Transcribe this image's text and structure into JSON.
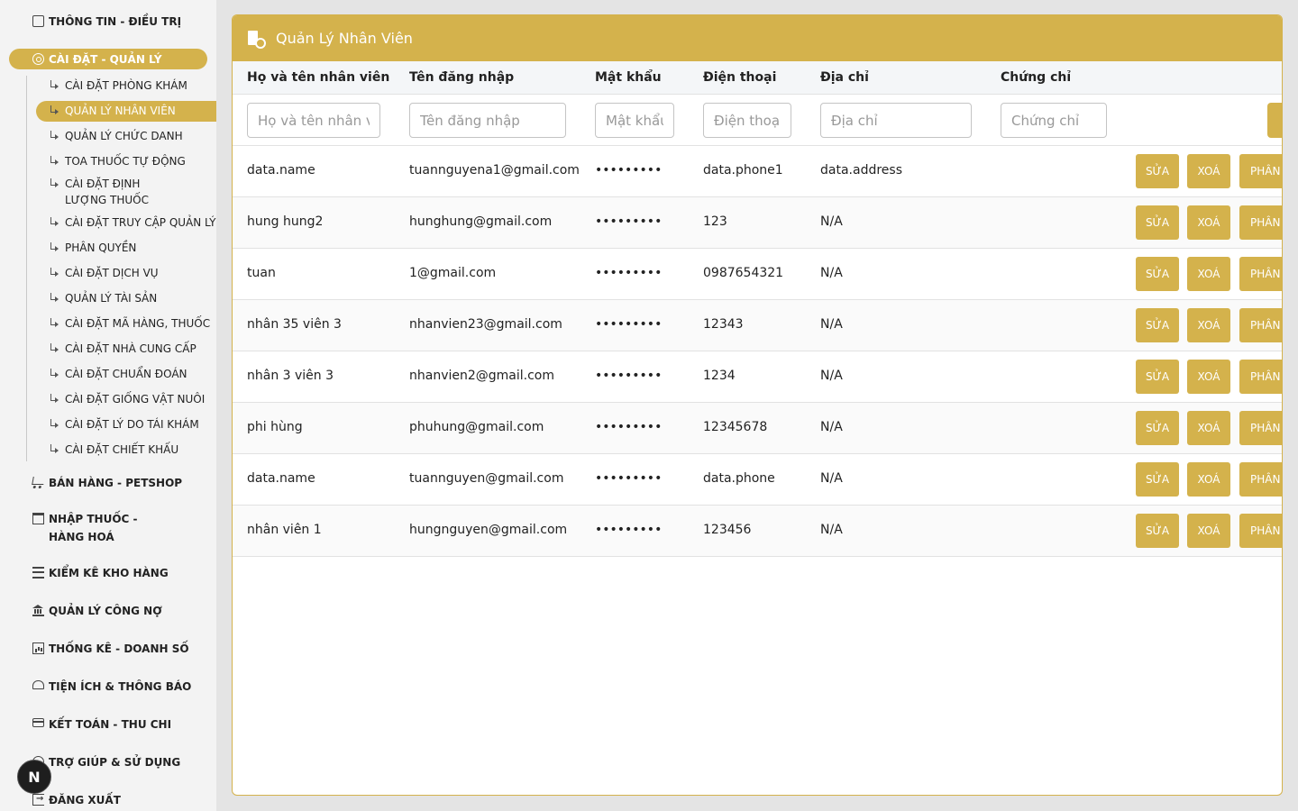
{
  "sidebar": {
    "top_item": "THÔNG TIN - ĐIỀU TRỊ",
    "active_group": "CÀI ĐẶT - QUẢN LÝ",
    "sub_items": [
      "CÀI ĐẶT PHÒNG KHÁM",
      "QUẢN LÝ NHÂN VIÊN",
      "QUẢN LÝ CHỨC DANH",
      "TOA THUỐC TỰ ĐỘNG",
      "CÀI ĐẶT ĐỊNH LƯỢNG THUỐC",
      "CÀI ĐẶT TRUY CẬP QUẢN LÝ",
      "PHÂN QUYỀN",
      "CÀI ĐẶT DỊCH VỤ",
      "QUẢN LÝ TÀI SẢN",
      "CÀI ĐẶT MÃ HÀNG, THUỐC",
      "CÀI ĐẶT NHÀ CUNG CẤP",
      "CÀI ĐẶT CHUẨN ĐOÁN",
      "CÀI ĐẶT GIỐNG VẬT NUÔI",
      "CÀI ĐẶT LÝ DO TÁI KHÁM",
      "CÀI ĐẶT CHIẾT KHẤU"
    ],
    "groups": [
      {
        "label": "BÁN HÀNG - PETSHOP",
        "icon": "cart-icon"
      },
      {
        "label": "NHẬP THUỐC - HÀNG HOÁ",
        "icon": "archive-icon"
      },
      {
        "label": "KIỂM KÊ KHO HÀNG",
        "icon": "list-icon"
      },
      {
        "label": "QUẢN LÝ CÔNG NỢ",
        "icon": "bank-icon"
      },
      {
        "label": "THỐNG KÊ - DOANH SỐ",
        "icon": "chart-icon"
      },
      {
        "label": "TIỆN ÍCH & THÔNG BÁO",
        "icon": "bell-icon"
      },
      {
        "label": "KẾT TOÁN - THU CHI",
        "icon": "card-icon"
      },
      {
        "label": "TRỢ GIÚP & SỬ DỤNG",
        "icon": "help-icon"
      },
      {
        "label": "ĐĂNG XUẤT",
        "icon": "logout-icon"
      }
    ],
    "badge": "N"
  },
  "panel": {
    "title": "Quản Lý Nhân Viên",
    "columns": [
      "Họ và tên nhân viên",
      "Tên đăng nhập",
      "Mật khẩu",
      "Điện thoại",
      "Địa chỉ",
      "Chứng chỉ"
    ],
    "filters": {
      "name": "Họ và tên nhân viên",
      "username": "Tên đăng nhập",
      "password": "Mật khẩu",
      "phone": "Điện thoại",
      "address": "Địa chỉ",
      "certificate": "Chứng chỉ"
    },
    "actions": {
      "edit": "SỬA",
      "delete": "XOÁ",
      "permission": "PHÂN"
    },
    "rows": [
      {
        "name": "data.name",
        "username": "tuannguyena1@gmail.com",
        "password": "•••••••••",
        "phone": "data.phone1",
        "address": "data.address"
      },
      {
        "name": "hung hung2",
        "username": "hunghung@gmail.com",
        "password": "•••••••••",
        "phone": "123",
        "address": "N/A"
      },
      {
        "name": "tuan",
        "username": "1@gmail.com",
        "password": "•••••••••",
        "phone": "0987654321",
        "address": "N/A"
      },
      {
        "name": "nhân 35 viên 3",
        "username": "nhanvien23@gmail.com",
        "password": "•••••••••",
        "phone": "12343",
        "address": "N/A"
      },
      {
        "name": "nhân 3 viên 3",
        "username": "nhanvien2@gmail.com",
        "password": "•••••••••",
        "phone": "1234",
        "address": "N/A"
      },
      {
        "name": "phi hùng",
        "username": "phuhung@gmail.com",
        "password": "•••••••••",
        "phone": "12345678",
        "address": "N/A"
      },
      {
        "name": "data.name",
        "username": "tuannguyen@gmail.com",
        "password": "•••••••••",
        "phone": "data.phone",
        "address": "N/A"
      },
      {
        "name": "nhân viên 1",
        "username": "hungnguyen@gmail.com",
        "password": "•••••••••",
        "phone": "123456",
        "address": "N/A"
      }
    ]
  },
  "colors": {
    "accent": "#d4b24c",
    "sidebar_bg": "#f3f3f3",
    "page_bg": "#e4e4e4"
  }
}
